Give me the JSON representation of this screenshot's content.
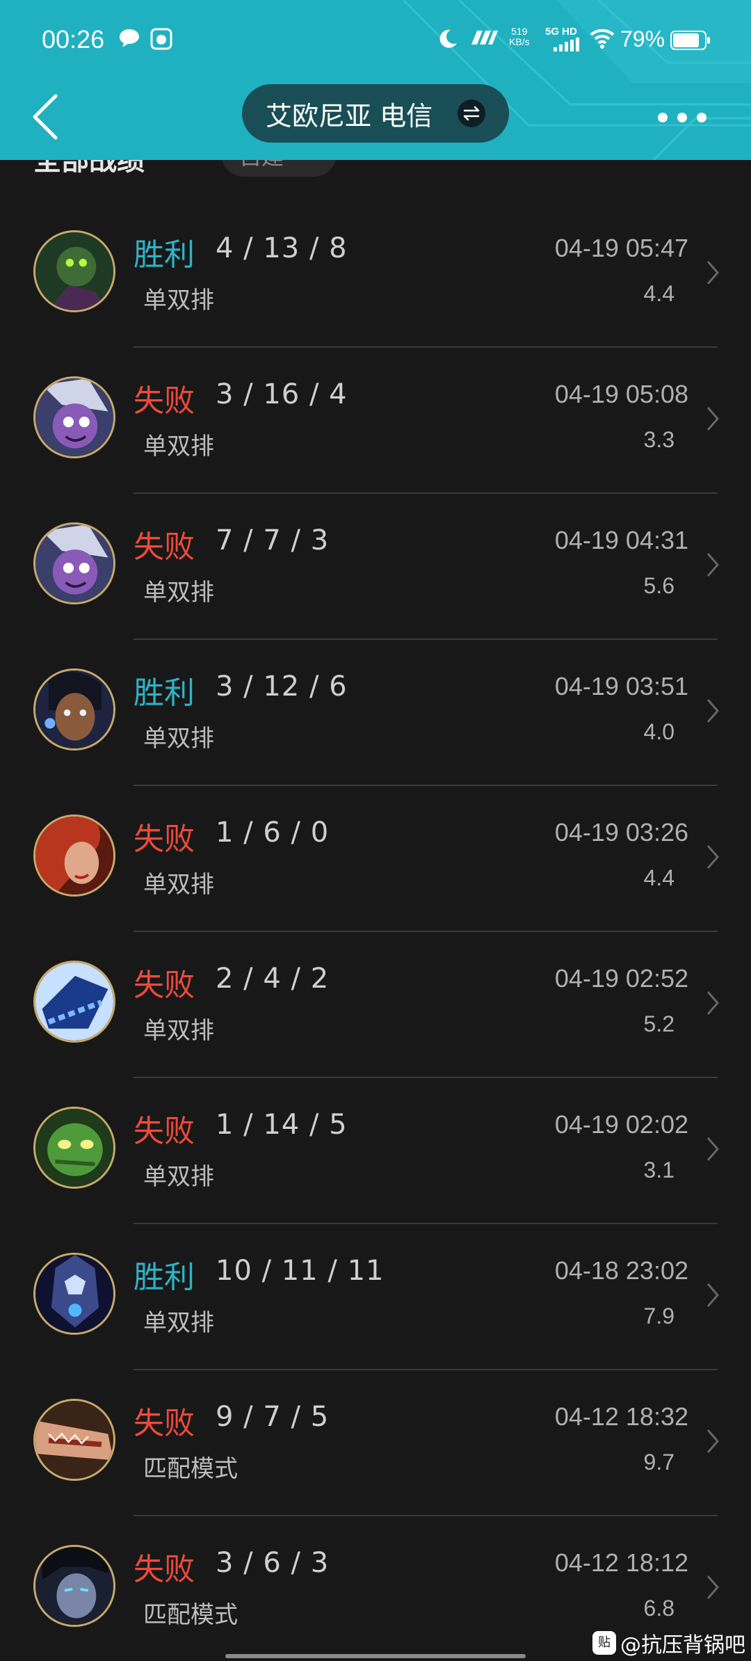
{
  "status_bar": {
    "time": "00:26",
    "net_speed_value": "519",
    "net_speed_unit": "KB/s",
    "net_type": "5G HD",
    "battery": "79%"
  },
  "header": {
    "server_name": "艾欧尼亚 电信",
    "accent_color": "#1fb1c0"
  },
  "filter": {
    "label": "全部战绩",
    "pill_label": "自建"
  },
  "matches": [
    {
      "result": "胜利",
      "outcome": "win",
      "kda": "4 / 13 / 8",
      "mode": "单双排",
      "datetime": "04-19 05:47",
      "score": "4.4",
      "champion_icon": "rat-champion-icon"
    },
    {
      "result": "失败",
      "outcome": "loss",
      "kda": "3 / 16 / 4",
      "mode": "单双排",
      "datetime": "04-19 05:08",
      "score": "3.3",
      "champion_icon": "purple-yordle-champion-icon"
    },
    {
      "result": "失败",
      "outcome": "loss",
      "kda": "7 / 7 / 3",
      "mode": "单双排",
      "datetime": "04-19 04:31",
      "score": "5.6",
      "champion_icon": "purple-yordle-champion-icon"
    },
    {
      "result": "胜利",
      "outcome": "win",
      "kda": "3 / 12 / 6",
      "mode": "单双排",
      "datetime": "04-19 03:51",
      "score": "4.0",
      "champion_icon": "dark-hair-champion-icon"
    },
    {
      "result": "失败",
      "outcome": "loss",
      "kda": "1 / 6 / 0",
      "mode": "单双排",
      "datetime": "04-19 03:26",
      "score": "4.4",
      "champion_icon": "red-hair-champion-icon"
    },
    {
      "result": "失败",
      "outcome": "loss",
      "kda": "2 / 4 / 2",
      "mode": "单双排",
      "datetime": "04-19 02:52",
      "score": "5.2",
      "champion_icon": "blue-chain-champion-icon"
    },
    {
      "result": "失败",
      "outcome": "loss",
      "kda": "1 / 14 / 5",
      "mode": "单双排",
      "datetime": "04-19 02:02",
      "score": "3.1",
      "champion_icon": "green-mummy-champion-icon"
    },
    {
      "result": "胜利",
      "outcome": "win",
      "kda": "10 / 11 / 11",
      "mode": "单双排",
      "datetime": "04-18 23:02",
      "score": "7.9",
      "champion_icon": "dark-armor-champion-icon"
    },
    {
      "result": "失败",
      "outcome": "loss",
      "kda": "9 / 7 / 5",
      "mode": "匹配模式",
      "datetime": "04-12 18:32",
      "score": "9.7",
      "champion_icon": "monster-jaw-champion-icon"
    },
    {
      "result": "失败",
      "outcome": "loss",
      "kda": "3 / 6 / 3",
      "mode": "匹配模式",
      "datetime": "04-12 18:12",
      "score": "6.8",
      "champion_icon": "dark-knight-champion-icon"
    }
  ],
  "watermark": {
    "logo": "贴",
    "text": "@抗压背锅吧"
  }
}
